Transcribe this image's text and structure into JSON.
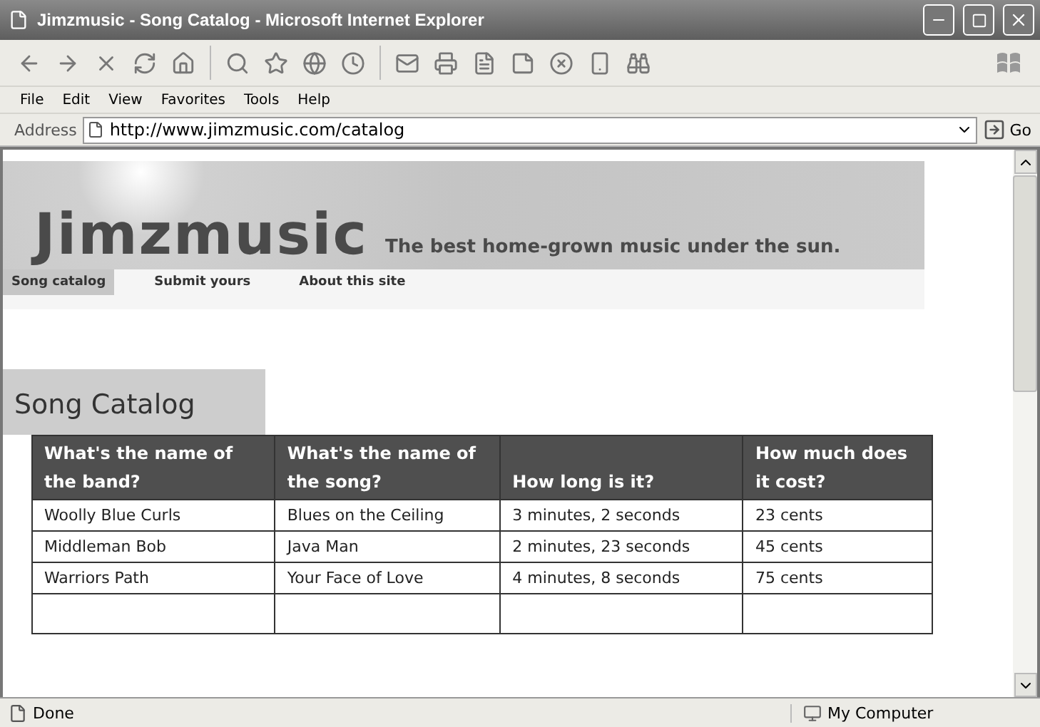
{
  "window": {
    "title": "Jimzmusic - Song Catalog - Microsoft Internet Explorer"
  },
  "menu": [
    "File",
    "Edit",
    "View",
    "Favorites",
    "Tools",
    "Help"
  ],
  "address_bar": {
    "label": "Address",
    "value": "http://www.jimzmusic.com/catalog",
    "go": "Go"
  },
  "site": {
    "name": "Jimzmusic",
    "tagline": "The best home-grown music under the sun.",
    "nav": [
      {
        "label": "Song catalog",
        "selected": true
      },
      {
        "label": "Submit yours",
        "selected": false
      },
      {
        "label": "About this site",
        "selected": false
      }
    ]
  },
  "heading": "Song Catalog",
  "table": {
    "columns": [
      "What's the name of the band?",
      "What's the name of the song?",
      "How long is it?",
      "How much does it cost?"
    ],
    "rows": [
      [
        "Woolly Blue Curls",
        "Blues on the Ceiling",
        "3 minutes, 2 seconds",
        "23 cents"
      ],
      [
        "Middleman Bob",
        "Java Man",
        "2 minutes, 23 seconds",
        "45 cents"
      ],
      [
        "Warriors Path",
        "Your Face of Love",
        "4 minutes, 8 seconds",
        "75 cents"
      ]
    ]
  },
  "status_bar": {
    "text": "Done",
    "zone": "My Computer"
  }
}
